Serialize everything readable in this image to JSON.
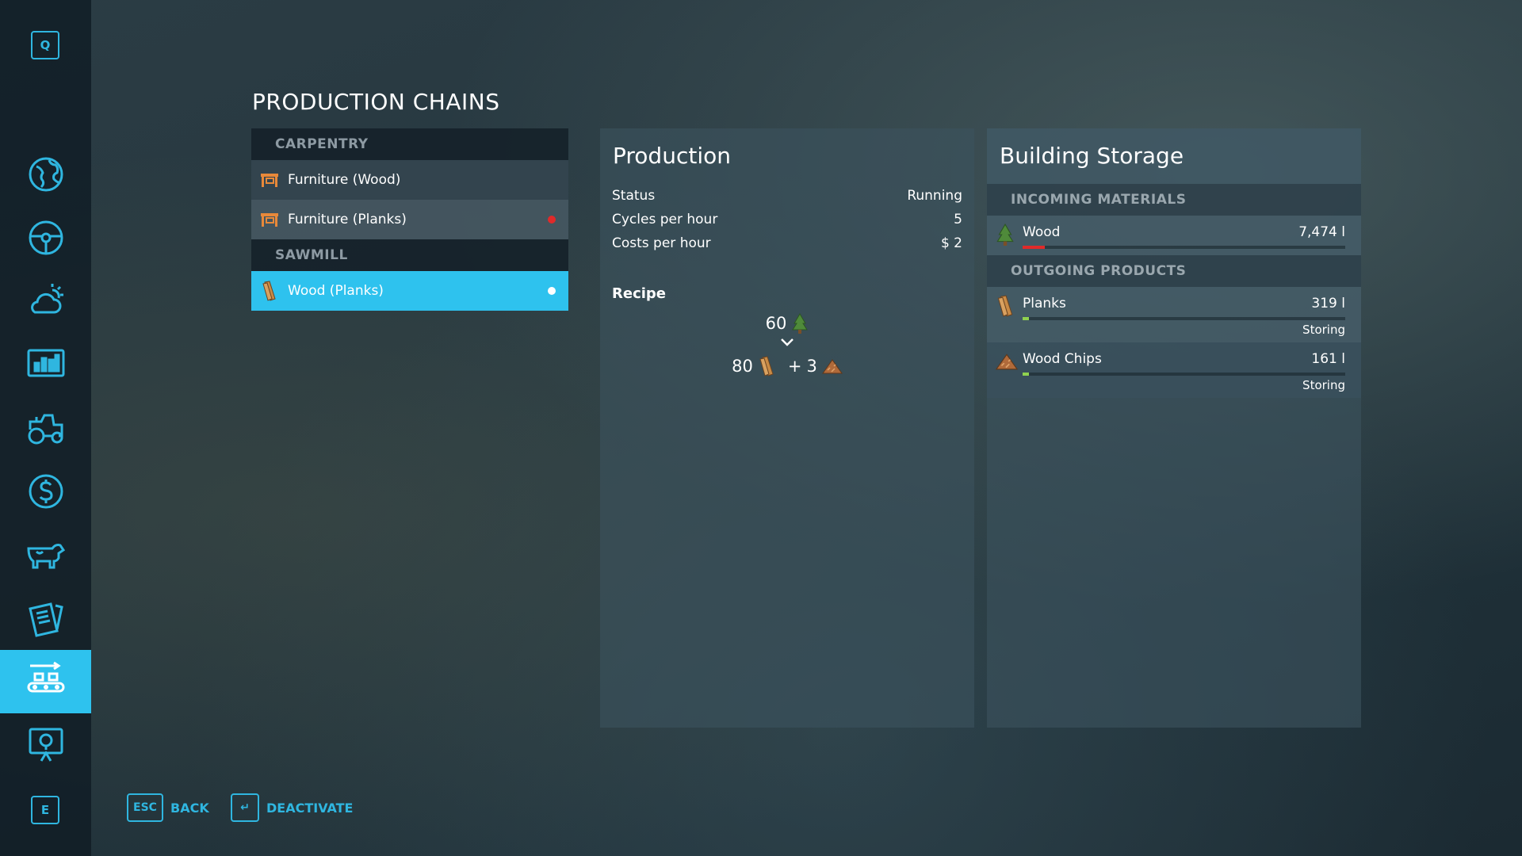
{
  "sidebar": {
    "top_key": "Q",
    "bottom_key": "E",
    "items": [
      {
        "icon": "map-globe-icon"
      },
      {
        "icon": "steering-wheel-icon"
      },
      {
        "icon": "weather-icon"
      },
      {
        "icon": "statistics-icon"
      },
      {
        "icon": "tractor-icon"
      },
      {
        "icon": "finances-dollar-icon"
      },
      {
        "icon": "animals-cow-icon"
      },
      {
        "icon": "contracts-icon"
      },
      {
        "icon": "production-chains-icon",
        "active": true
      },
      {
        "icon": "help-presentation-icon"
      }
    ]
  },
  "page": {
    "title": "PRODUCTION CHAINS"
  },
  "chains": {
    "groups": [
      {
        "name": "CARPENTRY",
        "items": [
          {
            "label": "Furniture (Wood)",
            "icon": "furniture-icon",
            "status": "none"
          },
          {
            "label": "Furniture (Planks)",
            "icon": "furniture-icon",
            "status": "inactive"
          }
        ]
      },
      {
        "name": "SAWMILL",
        "items": [
          {
            "label": "Wood (Planks)",
            "icon": "planks-icon",
            "status": "active",
            "selected": true
          }
        ]
      }
    ]
  },
  "production": {
    "title": "Production",
    "stats": [
      {
        "label": "Status",
        "value": "Running"
      },
      {
        "label": "Cycles per hour",
        "value": "5"
      },
      {
        "label": "Costs per hour",
        "value": "$ 2"
      }
    ],
    "recipe_title": "Recipe",
    "recipe": {
      "input_amount": "60",
      "input_icon": "tree-icon",
      "output_amount_1": "80",
      "output_icon_1": "planks-icon",
      "plus": "+",
      "output_amount_2": "3",
      "output_icon_2": "wood-chips-icon"
    }
  },
  "storage": {
    "title": "Building Storage",
    "incoming_header": "INCOMING MATERIALS",
    "incoming": [
      {
        "name": "Wood",
        "amount": "7,474 l",
        "fill": 0.07,
        "color": "#e02a2a",
        "icon": "tree-icon"
      }
    ],
    "outgoing_header": "OUTGOING PRODUCTS",
    "outgoing": [
      {
        "name": "Planks",
        "amount": "319 l",
        "fill": 0.02,
        "color": "#8fd14f",
        "mode": "Storing",
        "icon": "planks-icon"
      },
      {
        "name": "Wood Chips",
        "amount": "161 l",
        "fill": 0.02,
        "color": "#8fd14f",
        "mode": "Storing",
        "icon": "wood-chips-icon"
      }
    ]
  },
  "footer": {
    "back_key": "ESC",
    "back_label": "BACK",
    "deactivate_key": "↵",
    "deactivate_label": "DEACTIVATE"
  },
  "colors": {
    "accent": "#2ec2ee",
    "inactive_dot": "#e02a2a",
    "active_dot": "#ffffff",
    "fill_ok": "#8fd14f"
  }
}
